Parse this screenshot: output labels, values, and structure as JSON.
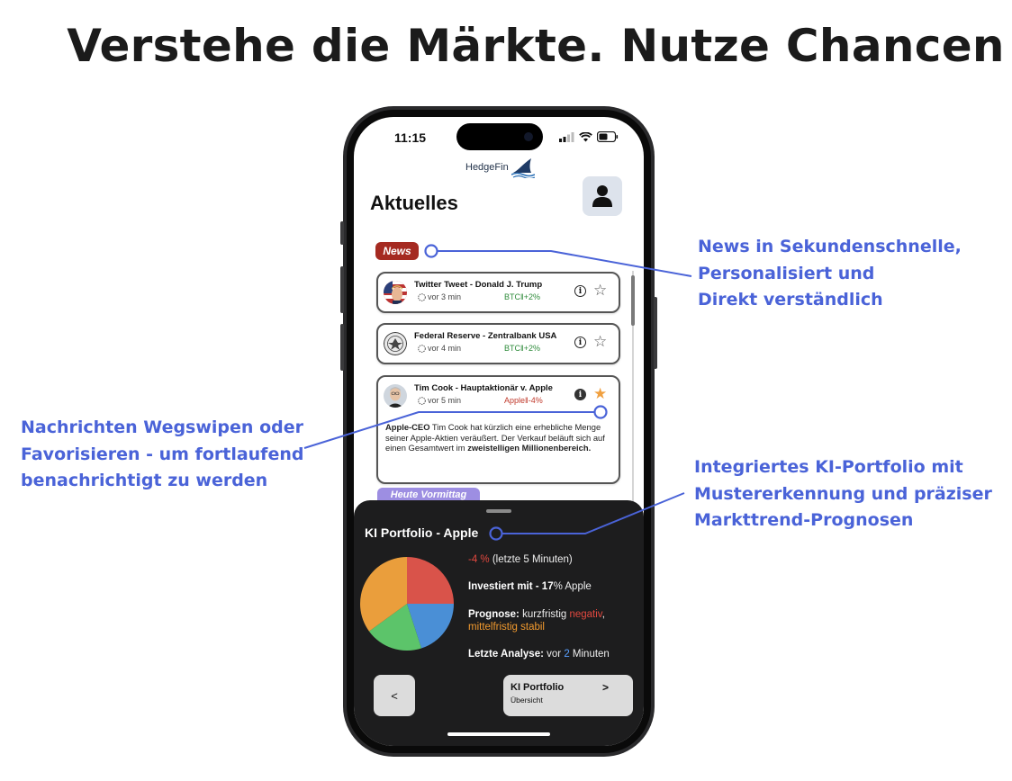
{
  "headline": "Verstehe die Märkte. Nutze Chancen",
  "callouts": {
    "news": [
      "News in Sekundenschnelle,",
      "Personalisiert und",
      "Direkt verständlich"
    ],
    "swipe": [
      "Nachrichten Wegswipen oder",
      "Favorisieren - um fortlaufend",
      "benachrichtigt zu werden"
    ],
    "portfolio": [
      "Integriertes KI-Portfolio mit",
      "Mustererkennung und präziser",
      "Markttrend-Prognosen"
    ]
  },
  "status_bar": {
    "time": "11:15"
  },
  "app": {
    "logo_text": "HedgeFin",
    "page_title": "Aktuelles",
    "news_label": "News",
    "section_label": "Heute Vormittag"
  },
  "news_items": [
    {
      "title": "Twitter Tweet - Donald J. Trump",
      "time": "vor 3 min",
      "tag": "BTC‖+2%",
      "tag_color": "#2e8b3a",
      "favorited": false,
      "star": "☆",
      "info": "i",
      "avatar": "trump-avatar-icon"
    },
    {
      "title": "Federal Reserve - Zentralbank USA",
      "time": "vor 4 min",
      "tag": "BTC‖+2%",
      "tag_color": "#2e8b3a",
      "favorited": false,
      "star": "☆",
      "info": "i",
      "avatar": "fed-seal-icon"
    },
    {
      "title": "Tim Cook - Hauptaktionär v. Apple",
      "time": "vor 5 min",
      "tag": "Apple‖-4%",
      "tag_color": "#c0392b",
      "favorited": true,
      "star": "★",
      "info": "i",
      "avatar": "tim-cook-avatar-icon",
      "body": {
        "lead": "Apple-CEO",
        "text": " Tim Cook hat kürzlich eine erhebliche Menge seiner Apple-Aktien veräußert. Der Verkauf beläuft sich auf einen Gesamtwert im ",
        "highlight": "zweistelligen Millionenbereich."
      }
    }
  ],
  "portfolio": {
    "title": "KI Portfolio - Apple",
    "change": {
      "value": "-4 %",
      "suffix": " (letzte 5 Minuten)"
    },
    "invested": {
      "label": "Investiert mit - 17",
      "suffix": "% Apple"
    },
    "forecast": {
      "label": "Prognose:",
      "short_text": " kurzfristig ",
      "short_value": "negativ",
      "comma": ",",
      "mid_value": "mittelfristig stabil"
    },
    "analysis": {
      "label": "Letzte Analyse:",
      "pre": " vor ",
      "value": "2",
      "post": " Minuten"
    },
    "back_label": "<",
    "nav_button": {
      "title": "KI Portfolio",
      "subtitle": "Übersicht",
      "arrow": ">"
    }
  },
  "chart_data": {
    "type": "pie",
    "slices": [
      {
        "label": "",
        "value": 25,
        "color": "#d9534a"
      },
      {
        "label": "",
        "value": 20,
        "color": "#4a8fd6"
      },
      {
        "label": "",
        "value": 20,
        "color": "#5cc46a"
      },
      {
        "label": "",
        "value": 35,
        "color": "#ea9e3c"
      }
    ]
  }
}
